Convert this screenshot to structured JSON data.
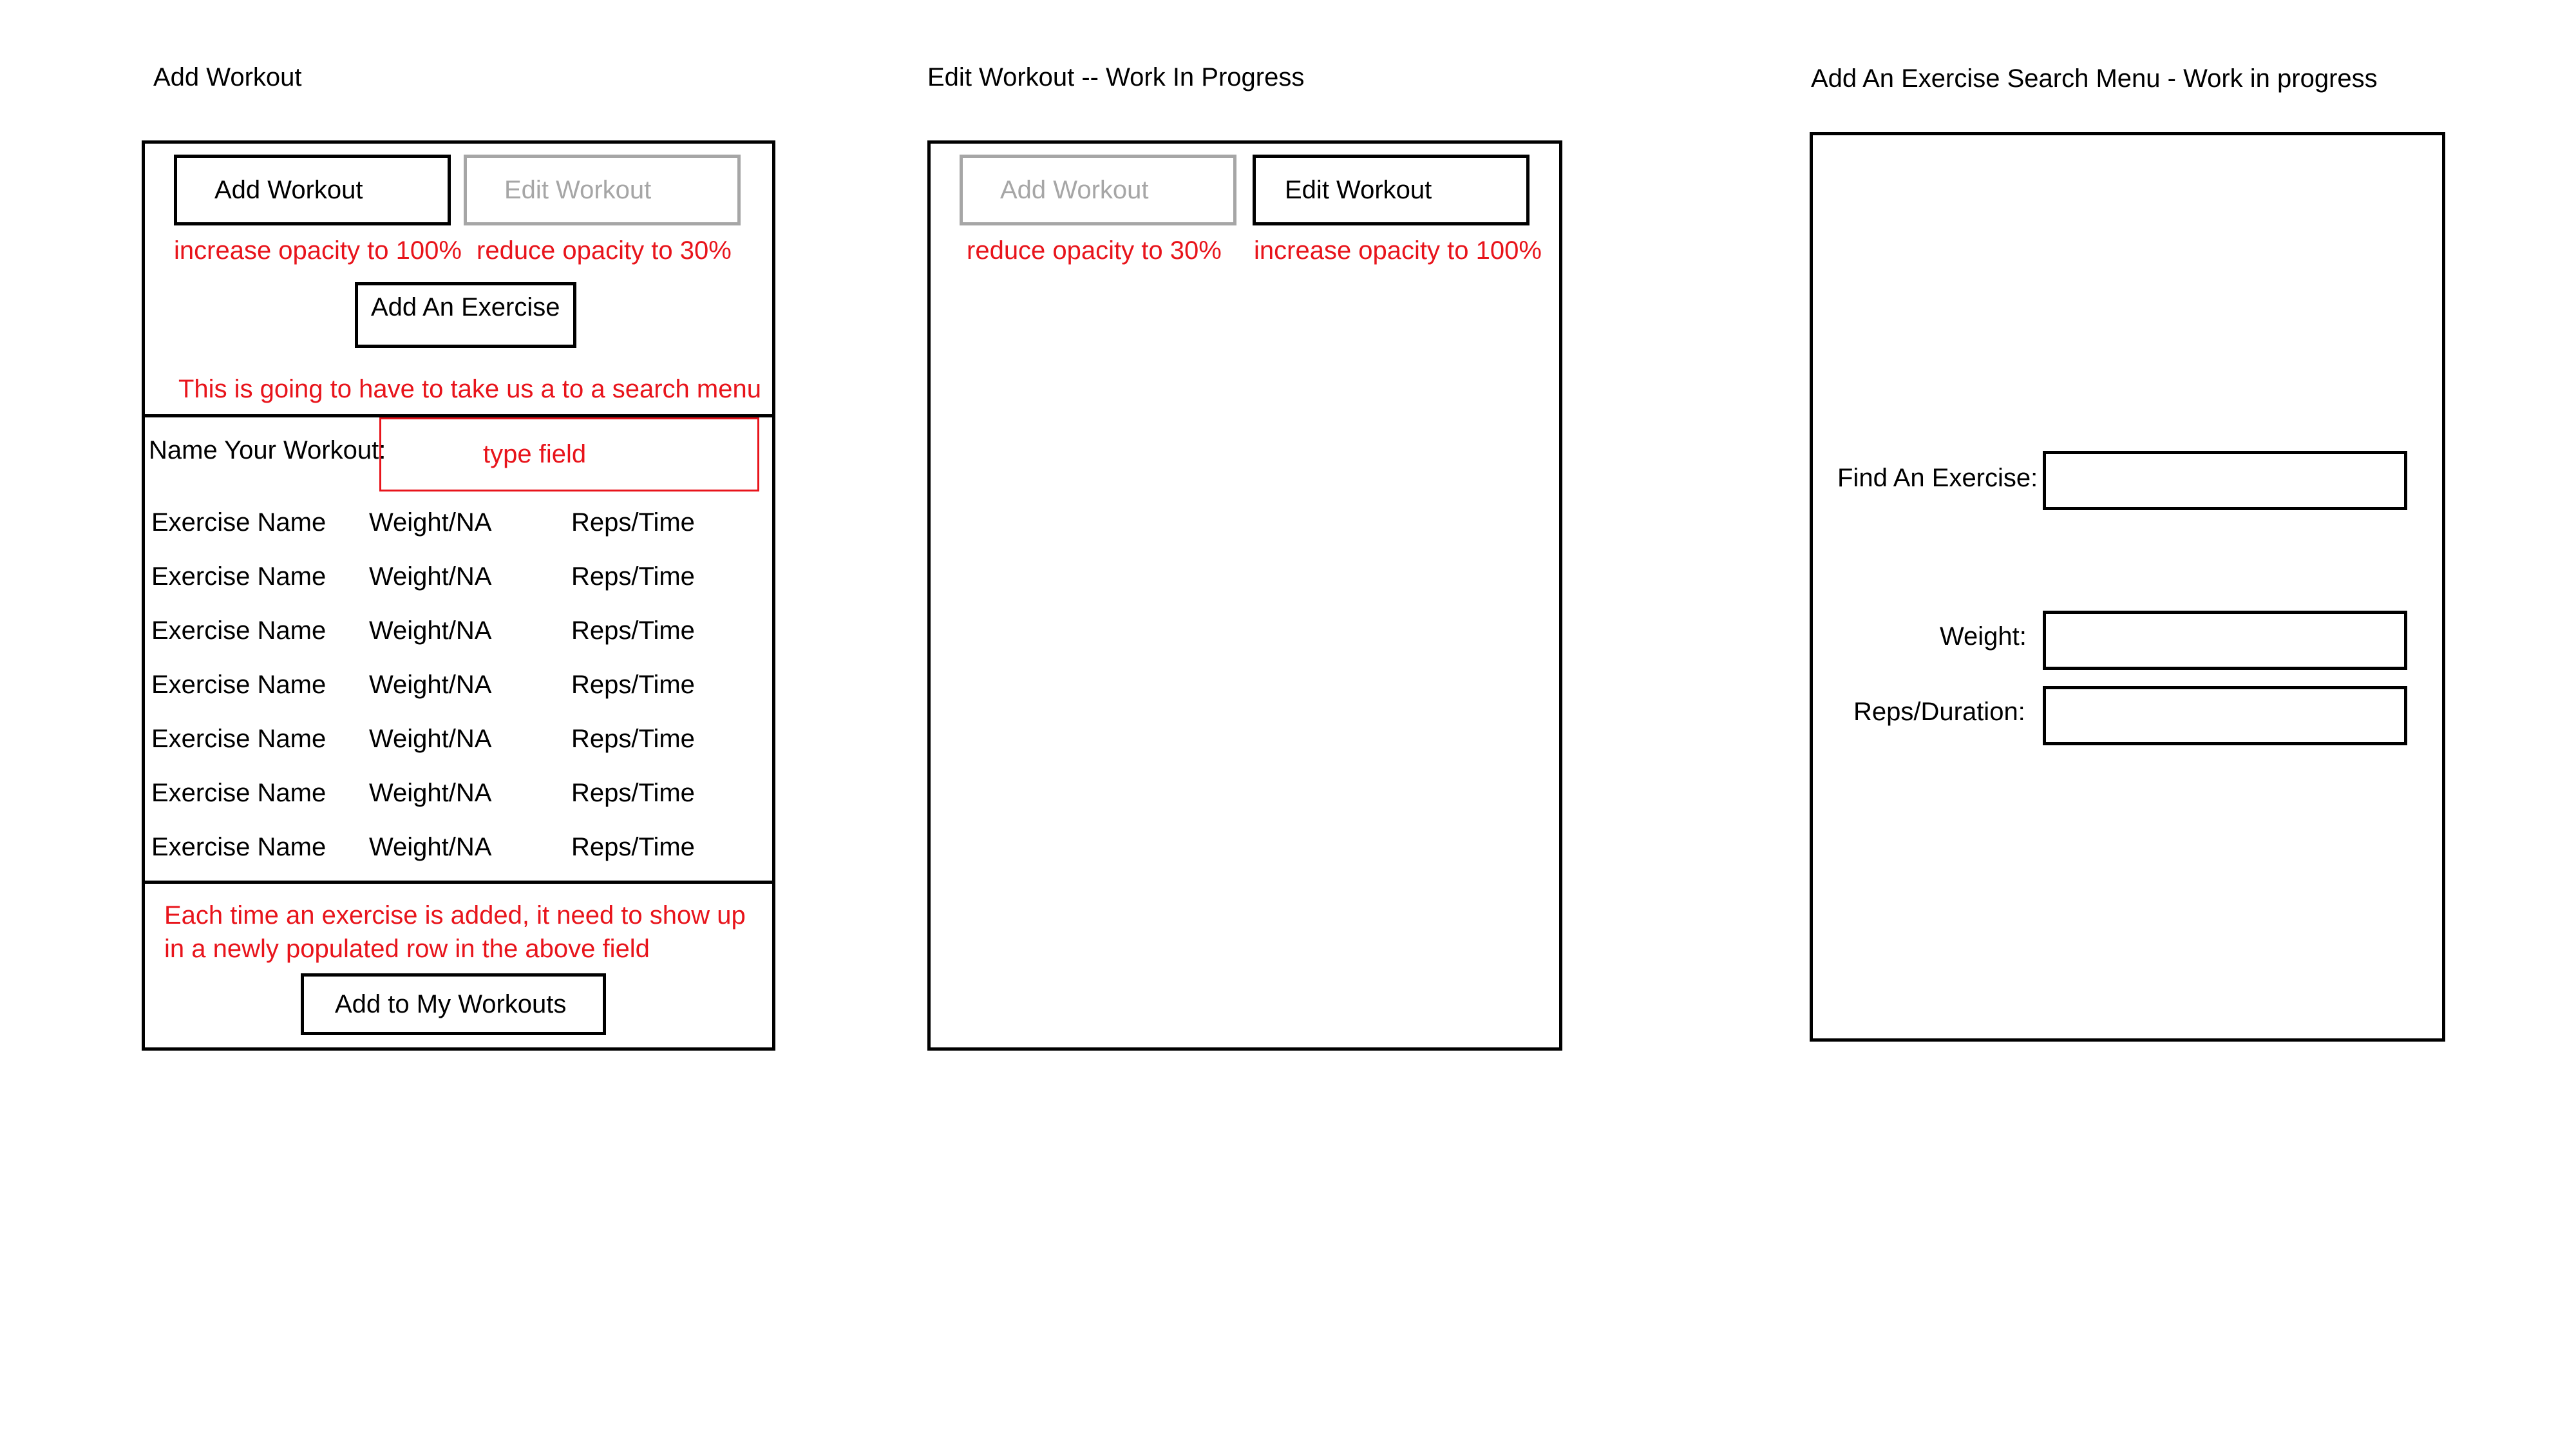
{
  "panels": {
    "add_workout": {
      "title": "Add Workout",
      "add_workout_button": "Add Workout",
      "edit_workout_button": "Edit Workout",
      "note_increase": "increase opacity to 100%",
      "note_reduce": "reduce opacity to 30%",
      "add_exercise_button": "Add An Exercise",
      "note_search": "This is going to have to take us a to a search menu",
      "name_label": "Name Your Workout:",
      "type_field_note": "type field",
      "rows": [
        {
          "name": "Exercise Name",
          "weight": "Weight/NA",
          "reps": "Reps/Time"
        },
        {
          "name": "Exercise Name",
          "weight": "Weight/NA",
          "reps": "Reps/Time"
        },
        {
          "name": "Exercise Name",
          "weight": "Weight/NA",
          "reps": "Reps/Time"
        },
        {
          "name": "Exercise Name",
          "weight": "Weight/NA",
          "reps": "Reps/Time"
        },
        {
          "name": "Exercise Name",
          "weight": "Weight/NA",
          "reps": "Reps/Time"
        },
        {
          "name": "Exercise Name",
          "weight": "Weight/NA",
          "reps": "Reps/Time"
        },
        {
          "name": "Exercise Name",
          "weight": "Weight/NA",
          "reps": "Reps/Time"
        }
      ],
      "note_rows_line1": "Each time an exercise is added, it need to show up",
      "note_rows_line2": "in a newly populated row in the above field",
      "add_to_my_workouts_button": "Add to My Workouts"
    },
    "edit_workout": {
      "title": "Edit Workout -- Work In Progress",
      "add_workout_button": "Add Workout",
      "edit_workout_button": "Edit Workout",
      "note_reduce": "reduce opacity to 30%",
      "note_increase": "increase opacity to 100%"
    },
    "search_menu": {
      "title": "Add An Exercise Search Menu - Work in progress",
      "find_label": "Find An Exercise:",
      "weight_label": "Weight:",
      "reps_label": "Reps/Duration:"
    }
  },
  "colors": {
    "annotation": "#e8141b",
    "dimmed": "#a6a6a6",
    "border": "#000000"
  }
}
